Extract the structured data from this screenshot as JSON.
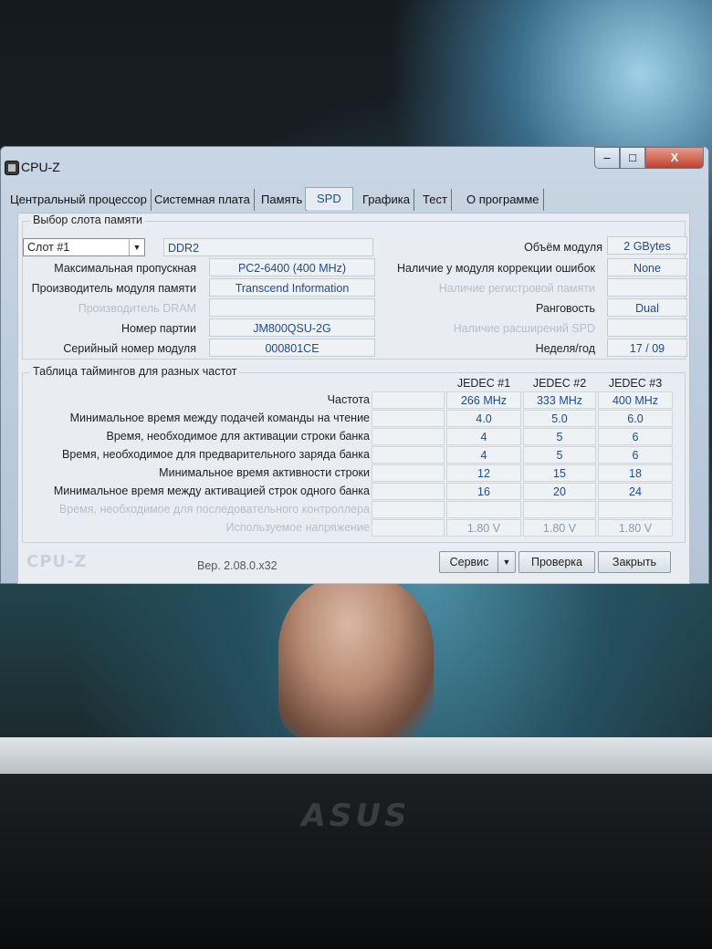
{
  "window": {
    "title": "CPU-Z",
    "close_symbol": "X",
    "minimize_symbol": "–",
    "maximize_symbol": "□"
  },
  "tabs": [
    {
      "label": "Центральный процессор"
    },
    {
      "label": "Системная плата"
    },
    {
      "label": "Память"
    },
    {
      "label": "SPD"
    },
    {
      "label": "Графика"
    },
    {
      "label": "Тест"
    },
    {
      "label": "О программе"
    }
  ],
  "active_tab": "SPD",
  "slot_group": {
    "title": "Выбор слота памяти",
    "slot_select": "Слот #1",
    "memory_type": "DDR2",
    "module_size_label": "Объём модуля",
    "module_size": "2 GBytes",
    "max_bandwidth_label": "Максимальная пропускная",
    "max_bandwidth": "PC2-6400 (400 MHz)",
    "ecc_label": "Наличие у модуля коррекции ошибок",
    "ecc": "None",
    "manufacturer_label": "Производитель модуля памяти",
    "manufacturer": "Transcend Information",
    "registered_label": "Наличие регистровой памяти",
    "dram_manufacturer_label": "Производитель DRAM",
    "ranks_label": "Ранговость",
    "ranks": "Dual",
    "part_number_label": "Номер партии",
    "part_number": "JM800QSU-2G",
    "spd_ext_label": "Наличие расширений SPD",
    "serial_label": "Серийный номер модуля",
    "serial": "000801CE",
    "week_year_label": "Неделя/год",
    "week_year": "17 / 09"
  },
  "timings": {
    "title": "Таблица таймингов для разных частот",
    "columns": [
      "JEDEC #1",
      "JEDEC #2",
      "JEDEC #3"
    ],
    "rows": [
      {
        "label": "Частота",
        "values": [
          "266 MHz",
          "333 MHz",
          "400 MHz"
        ],
        "dim": false
      },
      {
        "label": "Минимальное время между подачей команды на чтение",
        "values": [
          "4.0",
          "5.0",
          "6.0"
        ],
        "dim": false
      },
      {
        "label": "Время, необходимое для активации строки банка",
        "values": [
          "4",
          "5",
          "6"
        ],
        "dim": false
      },
      {
        "label": "Время, необходимое для предварительного заряда банка",
        "values": [
          "4",
          "5",
          "6"
        ],
        "dim": false
      },
      {
        "label": "Минимальное время активности строки",
        "values": [
          "12",
          "15",
          "18"
        ],
        "dim": false
      },
      {
        "label": "Минимальное время между активацией строк одного банка",
        "values": [
          "16",
          "20",
          "24"
        ],
        "dim": false
      },
      {
        "label": "Время, необходимое для последовательного контроллера",
        "values": [
          "",
          "",
          ""
        ],
        "dim": true
      },
      {
        "label": "Используемое напряжение",
        "values": [
          "1.80 V",
          "1.80 V",
          "1.80 V"
        ],
        "dim": true
      }
    ]
  },
  "footer": {
    "logo": "CPU-Z",
    "version": "Вер. 2.08.0.x32",
    "service_button": "Сервис",
    "check_button": "Проверка",
    "close_button": "Закрыть"
  },
  "laptop_brand": "ASUS"
}
